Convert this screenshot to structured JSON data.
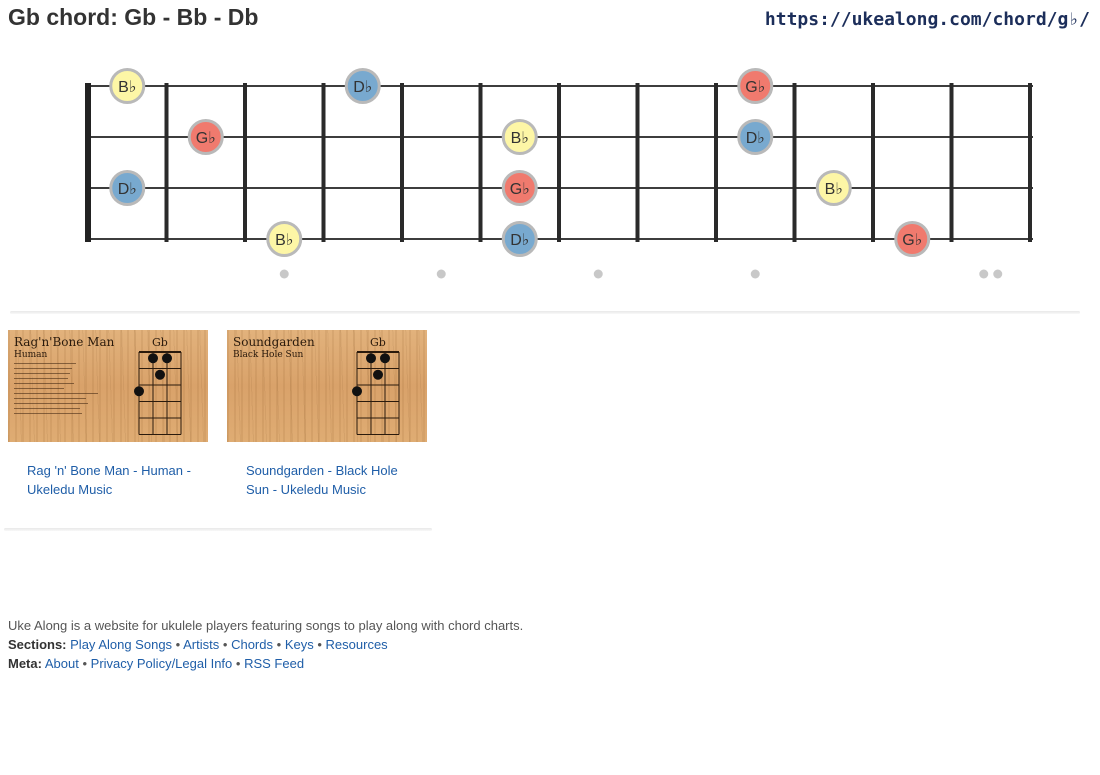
{
  "header": {
    "title": "Gb chord: Gb - Bb - Db",
    "url": "https://ukealong.com/chord/g♭/"
  },
  "fretboard": {
    "strings": 4,
    "frets": 12,
    "colors": {
      "root": "#f07a6e",
      "third": "#fdf6a6",
      "fifth": "#78a9cf",
      "outline": "#b9b9b9"
    },
    "notes": [
      {
        "string": 0,
        "fret": 1,
        "label": "B♭",
        "role": "third"
      },
      {
        "string": 0,
        "fret": 4,
        "label": "D♭",
        "role": "fifth"
      },
      {
        "string": 0,
        "fret": 9,
        "label": "G♭",
        "role": "root"
      },
      {
        "string": 1,
        "fret": 2,
        "label": "G♭",
        "role": "root"
      },
      {
        "string": 1,
        "fret": 6,
        "label": "B♭",
        "role": "third"
      },
      {
        "string": 1,
        "fret": 9,
        "label": "D♭",
        "role": "fifth"
      },
      {
        "string": 2,
        "fret": 1,
        "label": "D♭",
        "role": "fifth"
      },
      {
        "string": 2,
        "fret": 6,
        "label": "G♭",
        "role": "root"
      },
      {
        "string": 2,
        "fret": 10,
        "label": "B♭",
        "role": "third"
      },
      {
        "string": 3,
        "fret": 3,
        "label": "B♭",
        "role": "third"
      },
      {
        "string": 3,
        "fret": 6,
        "label": "D♭",
        "role": "fifth"
      },
      {
        "string": 3,
        "fret": 11,
        "label": "G♭",
        "role": "root"
      }
    ],
    "markers": [
      {
        "fret": 3,
        "count": 1
      },
      {
        "fret": 5,
        "count": 1
      },
      {
        "fret": 7,
        "count": 1
      },
      {
        "fret": 9,
        "count": 1
      },
      {
        "fret": 12,
        "count": 2
      }
    ]
  },
  "songs": [
    {
      "link": "Rag 'n' Bone Man - Human - Ukeledu Music",
      "thumb_artist": "Rag'n'Bone Man",
      "thumb_song": "Human",
      "thumb_chord": "Gb",
      "has_lyrics": true,
      "dots": [
        [
          2,
          0
        ],
        [
          4,
          0
        ],
        [
          3,
          1
        ],
        [
          0,
          2
        ]
      ]
    },
    {
      "link": "Soundgarden - Black Hole Sun - Ukeledu Music",
      "thumb_artist": "Soundgarden",
      "thumb_song": "Black Hole Sun",
      "thumb_chord": "Gb",
      "has_lyrics": false,
      "dots": [
        [
          2,
          0
        ],
        [
          4,
          0
        ],
        [
          3,
          1
        ],
        [
          0,
          2
        ]
      ]
    }
  ],
  "footer": {
    "about_text": "Uke Along is a website for ukulele players featuring songs to play along with chord charts.",
    "sections_label": "Sections:",
    "sections": [
      "Play Along Songs",
      "Artists",
      "Chords",
      "Keys",
      "Resources"
    ],
    "meta_label": "Meta:",
    "meta": [
      "About",
      "Privacy Policy/Legal Info",
      "RSS Feed"
    ],
    "separator": "•"
  }
}
